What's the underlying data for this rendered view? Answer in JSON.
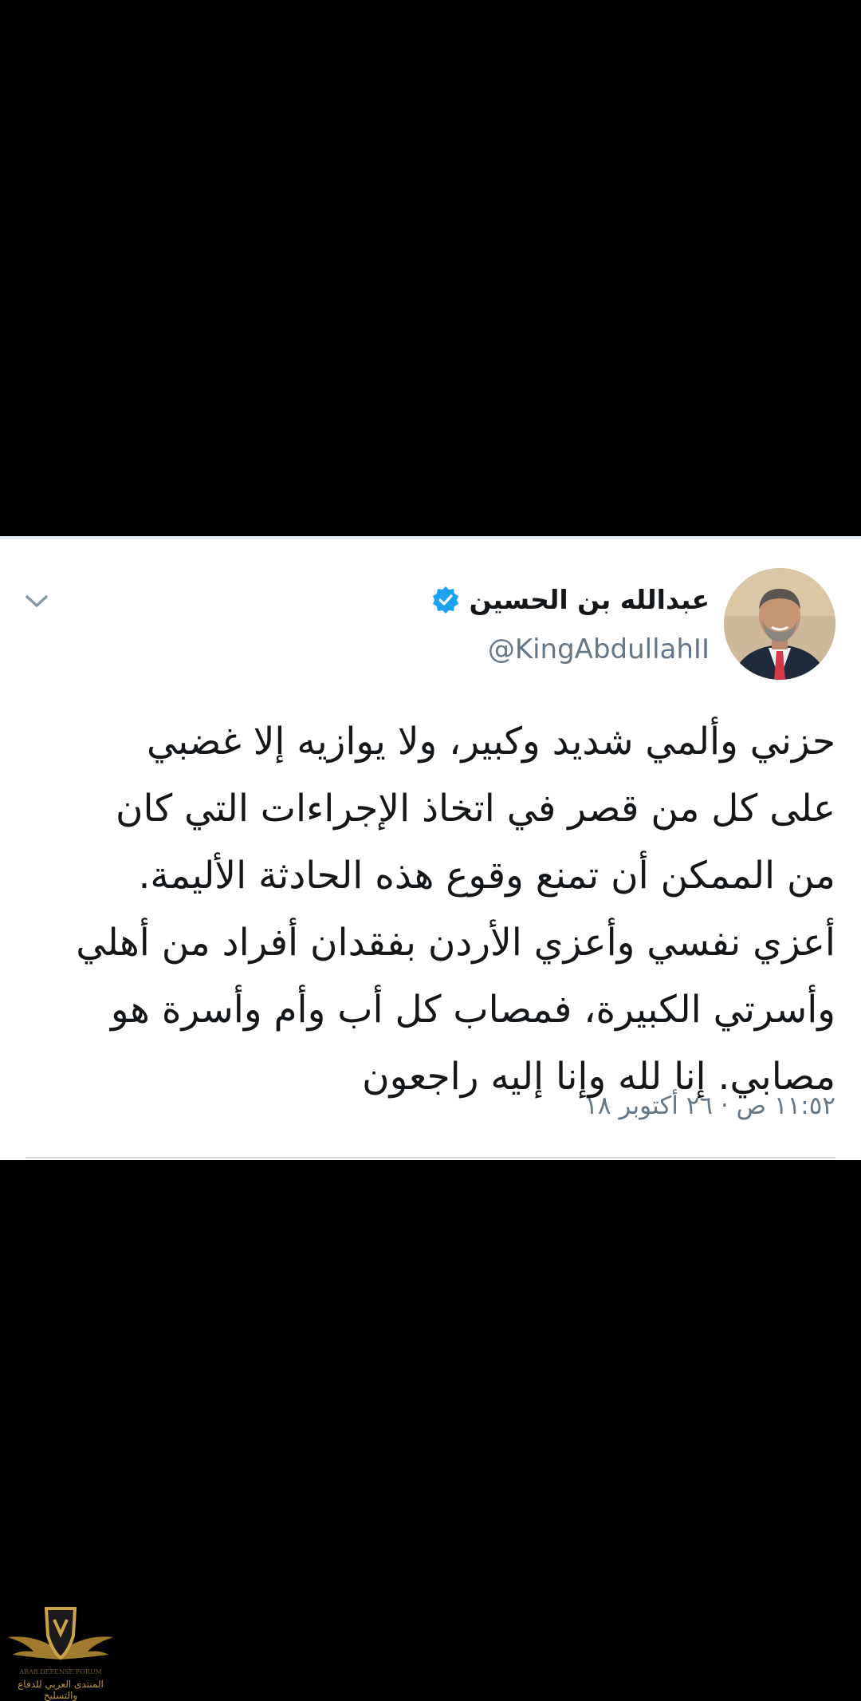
{
  "tweet": {
    "display_name": "عبدالله بن الحسين",
    "handle": "@KingAbdullahII",
    "verified": true,
    "text_lines": [
      "حزني وألمي شديد وكبير، ولا يوازيه إلا غضبي",
      "على كل من قصر في اتخاذ الإجراءات التي كان",
      "من الممكن أن تمنع وقوع هذه الحادثة الأليمة.",
      "أعزي نفسي وأعزي الأردن بفقدان أفراد من أهلي",
      "وأسرتي الكبيرة، فمصاب كل أب وأم وأسرة هو",
      "مصابي. إنا لله وإنا إليه راجعون"
    ],
    "timestamp": "١١:٥٢ ص · ٢٦ أكتوبر ١٨",
    "icons": {
      "verified": "verified-badge-icon",
      "menu": "chevron-down-icon",
      "avatar": "profile-photo"
    },
    "colors": {
      "verified_blue": "#1da1f2",
      "text": "#14171a",
      "muted": "#657786",
      "background": "#ffffff"
    }
  },
  "watermark": {
    "caption": "المنتدى العربي للدفاع والتسليح",
    "icon": "shield-wings-logo"
  }
}
